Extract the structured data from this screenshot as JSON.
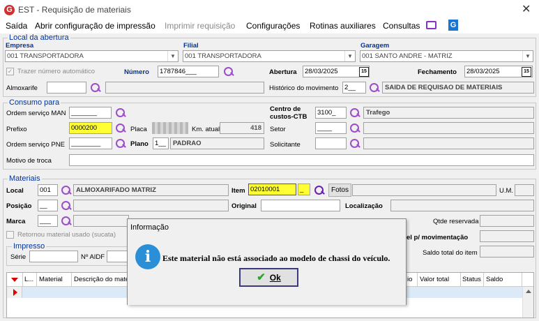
{
  "window": {
    "title": "EST - Requisição de materiais",
    "app_icon": "G",
    "close": "✕"
  },
  "menu": {
    "items": [
      "Saída",
      "Abrir configuração de impressão",
      "Imprimir requisição",
      "Configurações",
      "Rotinas auxiliares",
      "Consultas"
    ]
  },
  "local_abertura": {
    "group_title": "Local da abertura",
    "empresa_label": "Empresa",
    "empresa_value": "001 TRANSPORTADORA",
    "filial_label": "Filial",
    "filial_value": "001 TRANSPORTADORA",
    "garagem_label": "Garagem",
    "garagem_value": "001 SANTO ANDRE - MATRIZ",
    "trazer_label": "Trazer número automático",
    "numero_label": "Número",
    "numero_value": "1787846___",
    "abertura_label": "Abertura",
    "abertura_value": "28/03/2025",
    "fechamento_label": "Fechamento",
    "fechamento_value": "28/03/2025",
    "cal_icon": "15",
    "almoxarife_label": "Almoxarife",
    "almoxarife_value": "",
    "historico_label": "Histórico do movimento",
    "historico_code": "2__",
    "historico_desc": "SAIDA DE REQUISAO DE MATERIAIS"
  },
  "consumo": {
    "group_title": "Consumo para",
    "ordem_man_label": "Ordem serviço MAN",
    "ordem_man_value": "_______",
    "prefixo_label": "Prefixo",
    "prefixo_value": "0000200",
    "placa_label": "Placa",
    "km_label": "Km. atual",
    "km_value": "418",
    "ordem_pne_label": "Ordem serviço PNE",
    "ordem_pne_value": "________",
    "plano_label": "Plano",
    "plano_code": "1__",
    "plano_desc": "PADRAO",
    "centro_label_1": "Centro de",
    "centro_label_2": "custos-CTB",
    "centro_code": "3100_",
    "centro_desc": "Trafego",
    "setor_label": "Setor",
    "setor_value": "____",
    "solicitante_label": "Solicitante",
    "motivo_label": "Motivo de troca"
  },
  "materiais": {
    "group_title": "Materiais",
    "local_label": "Local",
    "local_code": "001",
    "local_desc": "ALMOXARIFADO MATRIZ",
    "item_label": "Item",
    "item_code": "02010001",
    "item_sub": "_",
    "fotos_label": "Fotos",
    "um_label": "U.M.",
    "posicao_label": "Posição",
    "posicao_value": "__",
    "original_label": "Original",
    "localizacao_label": "Localização",
    "marca_label": "Marca",
    "marca_value": "___",
    "qtde_label": "Qtde reservada",
    "retornou_label": "Retornou material usado (sucata)",
    "movimentacao_label": "el p/ movimentação",
    "impresso_title": "Impresso",
    "serie_label": "Série",
    "aidf_label": "Nº AIDF",
    "saldo_label": "Saldo total do item"
  },
  "grid": {
    "columns": [
      "L...",
      "Material",
      "Descrição do mate",
      "io",
      "Valor total",
      "Status",
      "Saldo"
    ]
  },
  "dialog": {
    "title": "Informação",
    "message": "Este material não está associado ao modelo de chassi do veículo.",
    "ok_label": "Ok",
    "info_icon": "i"
  }
}
